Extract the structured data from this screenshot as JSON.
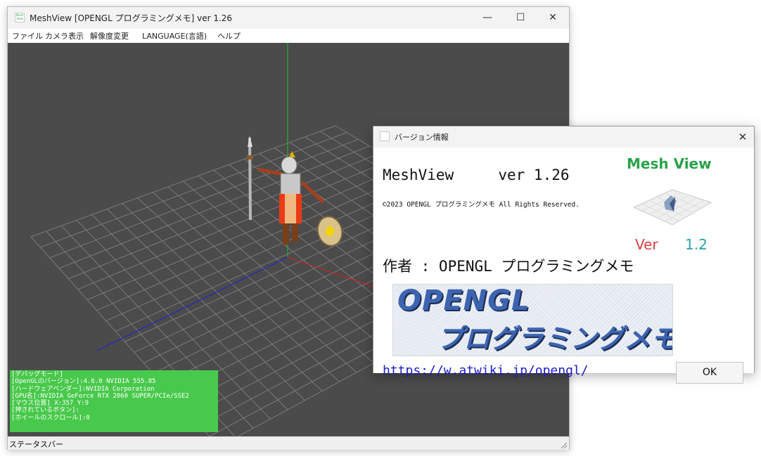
{
  "main_window": {
    "title": "MeshView [OPENGL プログラミングメモ] ver 1.26",
    "icon_text": "Mesh View",
    "controls": {
      "minimize": "—",
      "maximize": "☐",
      "close": "✕"
    },
    "menu": [
      "ファイル",
      "カメラ表示",
      "解像度変更",
      "LANGUAGE(言語)",
      "ヘルプ"
    ]
  },
  "debug": {
    "lines": [
      "[デバッグモード]",
      "[OpenGLのバージョン]:4.6.0 NVIDIA 555.85",
      "[ハードウェアベンダー]:NVIDIA Corporation",
      "[GPU名]:NVIDIA GeForce RTX 2060 SUPER/PCIe/SSE2",
      "[マウス位置] X:357 Y:9",
      "[押されているボタン]:",
      "[ホイールのスクロール]:0"
    ]
  },
  "statusbar": {
    "text": "ステータスバー"
  },
  "dialog": {
    "title": "バージョン情報",
    "close": "✕",
    "app_name": "MeshView     ver 1.26",
    "copyright": "©2023 OPENGL プログラミングメモ All Rights Reserved.",
    "logo": {
      "title": "Mesh View",
      "ver_label": "Ver",
      "ver_number": "1.2"
    },
    "author": "作者 : OPENGL プログラミングメモ",
    "banner": {
      "line1": "OPENGL",
      "line2": "プログラミングメモ"
    },
    "url": "https://w.atwiki.jp/opengl/",
    "ok_label": "OK"
  },
  "colors": {
    "viewport_bg": "#4b4b4b",
    "debug_bg": "#49c94c",
    "axis_x": "#d02020",
    "axis_y": "#20c020",
    "axis_z": "#2020d0",
    "logo_green": "#2aa24a",
    "logo_red": "#d43f3f",
    "link_blue": "#1c1cc8"
  }
}
